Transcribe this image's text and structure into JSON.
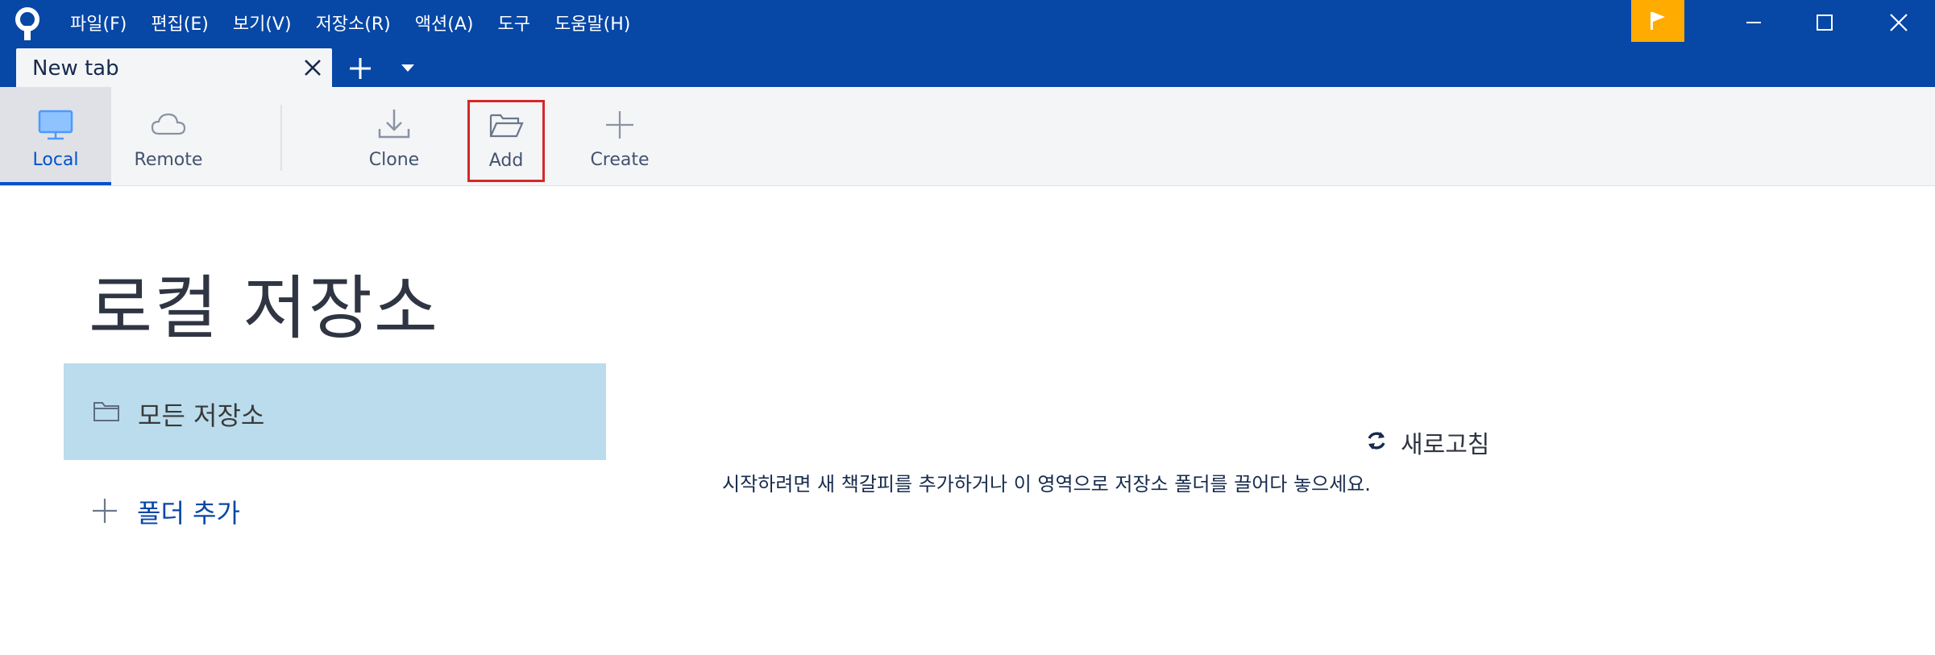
{
  "menu": {
    "items": [
      "파일(F)",
      "편집(E)",
      "보기(V)",
      "저장소(R)",
      "액션(A)",
      "도구",
      "도움말(H)"
    ]
  },
  "tab": {
    "title": "New tab"
  },
  "toolbar": {
    "local_label": "Local",
    "remote_label": "Remote",
    "clone_label": "Clone",
    "add_label": "Add",
    "create_label": "Create"
  },
  "main": {
    "page_title": "로컬 저장소",
    "all_repos_label": "모든 저장소",
    "add_folder_label": "폴더 추가",
    "refresh_label": "새로고침",
    "hint_text": "시작하려면 새 책갈피를 추가하거나 이 영역으로 저장소 폴더를 끌어다 놓으세요."
  },
  "colors": {
    "titlebar": "#0747a6",
    "accent": "#0052cc",
    "flag": "#ffab00",
    "selection": "#bbdcec",
    "highlight_box": "#d62828"
  },
  "icons": {
    "app": "sourcetree-logo-icon",
    "flag": "flag-icon",
    "local": "monitor-icon",
    "remote": "cloud-icon",
    "clone": "download-icon",
    "add": "open-folder-icon",
    "create": "plus-icon",
    "refresh": "refresh-icon"
  }
}
